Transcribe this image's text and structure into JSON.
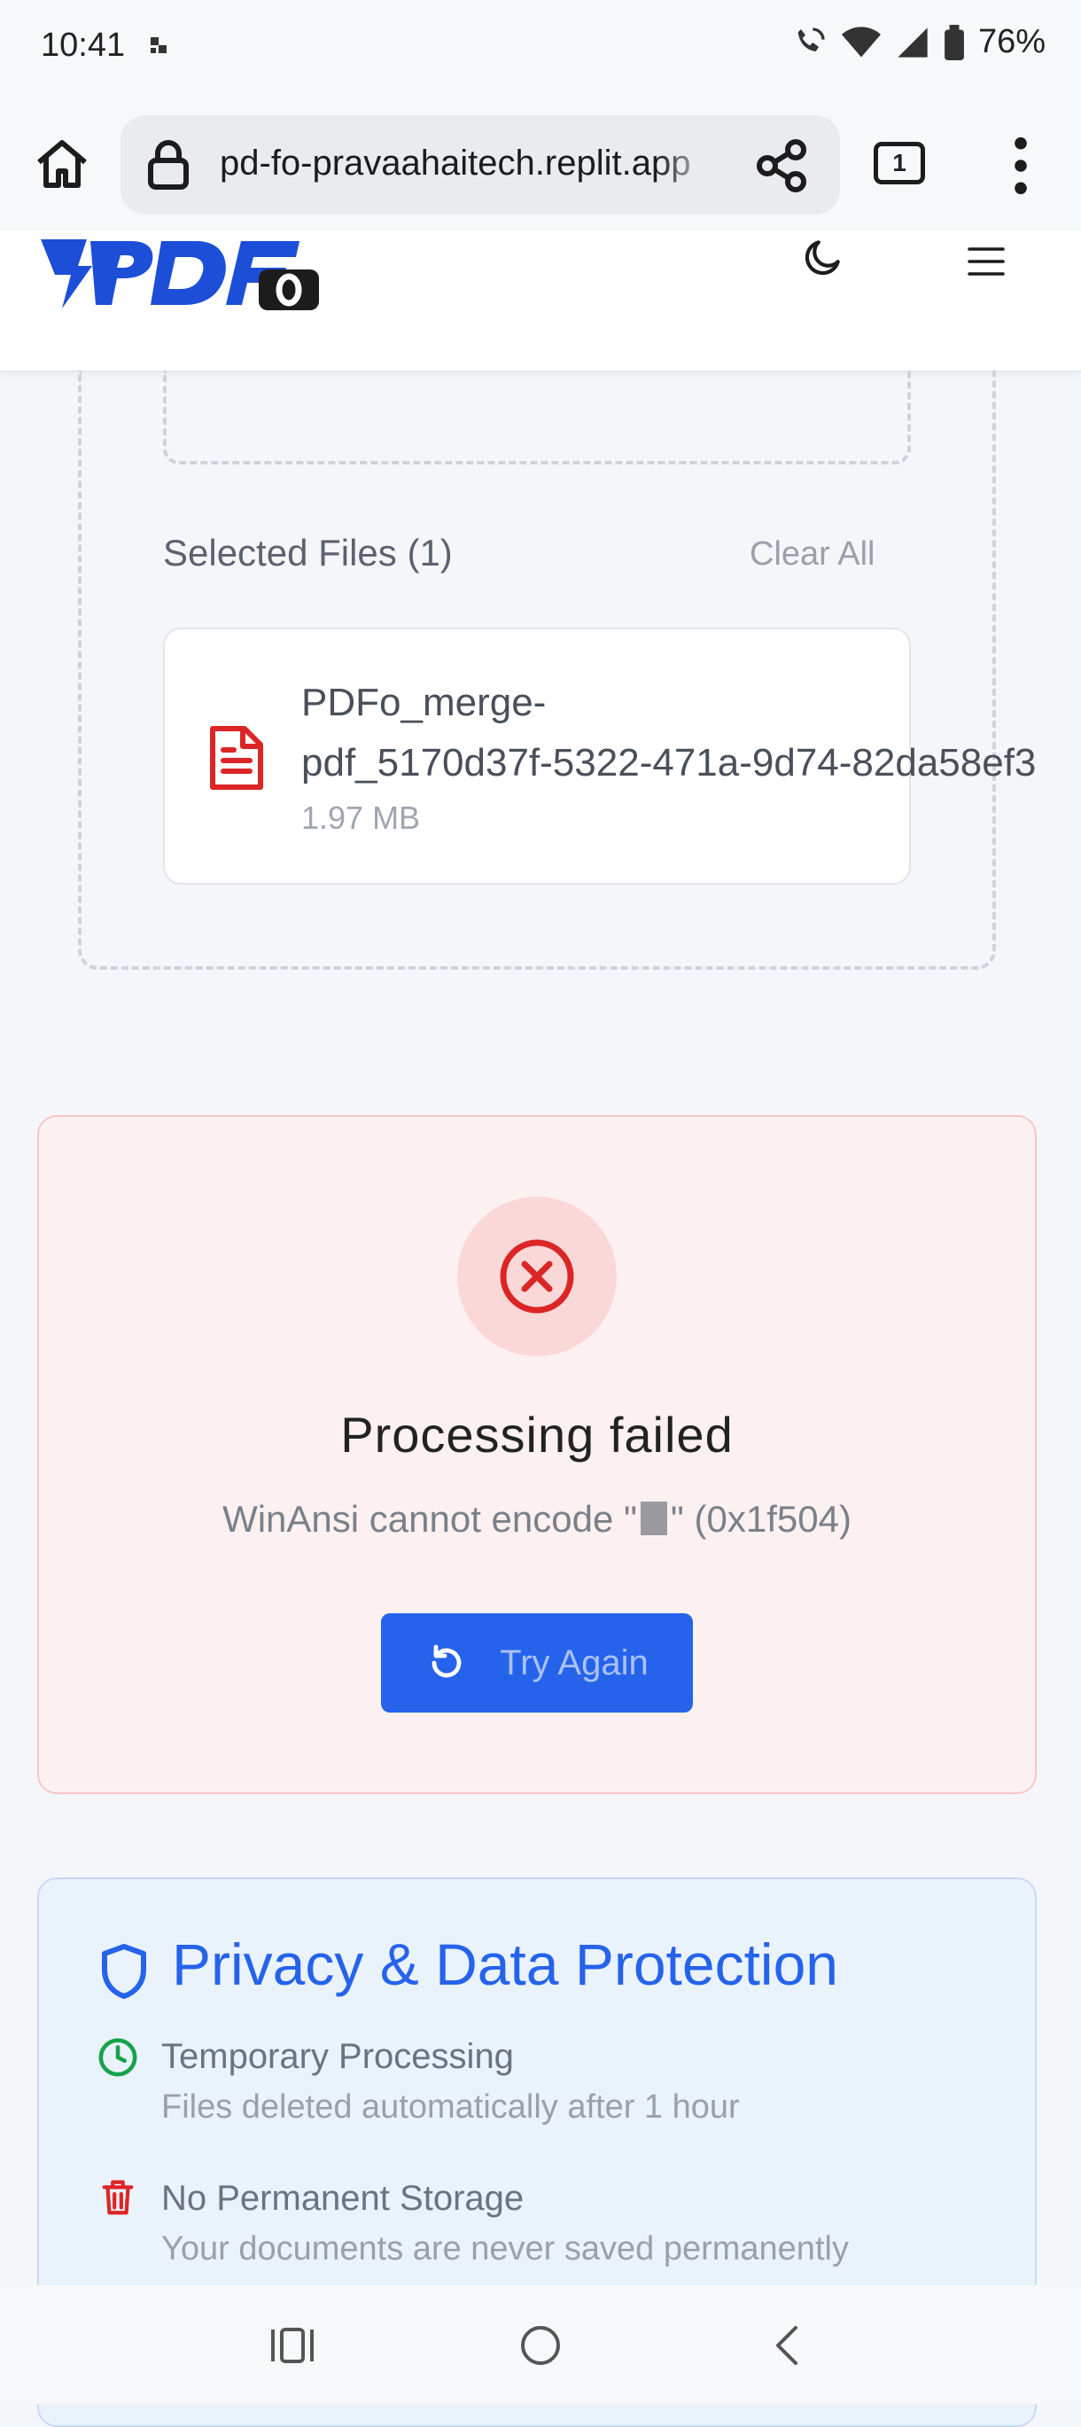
{
  "status_bar": {
    "time": "10:41",
    "battery": "76%"
  },
  "browser": {
    "url": "pd-fo-pravaahaitech.replit.app",
    "tab_count": "1"
  },
  "site": {
    "upload": {
      "selected_files_label": "Selected Files (1)",
      "clear_all_label": "Clear All",
      "files": [
        {
          "name_line1": "PDFo_merge-",
          "name_line2": "pdf_5170d37f-5322-471a-9d74-82da58ef3",
          "size": "1.97 MB"
        }
      ]
    },
    "error": {
      "title": "Processing failed",
      "message_prefix": "WinAnsi cannot encode \"",
      "message_suffix": "\" (0x1f504)",
      "retry_label": "Try Again"
    },
    "privacy": {
      "title": "Privacy & Data Protection",
      "items": [
        {
          "icon": "clock-icon",
          "title": "Temporary Processing",
          "description": "Files deleted automatically after 1 hour",
          "color": "#16a34a"
        },
        {
          "icon": "trash-icon",
          "title": "No Permanent Storage",
          "description": "Your documents are never saved permanently",
          "color": "#dc2626"
        }
      ]
    }
  },
  "colors": {
    "accent": "#2563eb",
    "error": "#dc2626",
    "error_bg": "#fdf0f0",
    "privacy_bg": "#eaf2fc"
  }
}
